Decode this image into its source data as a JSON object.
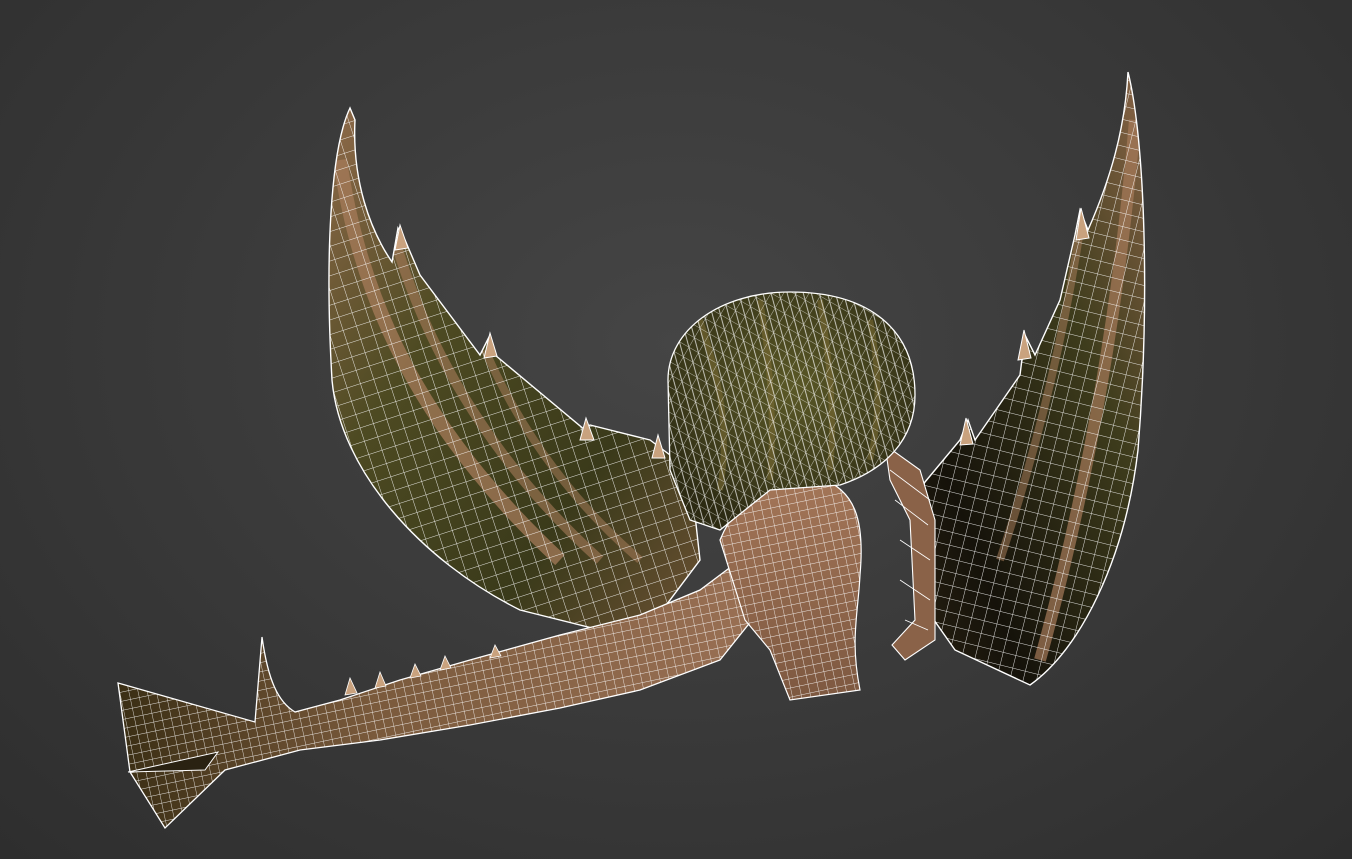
{
  "viewport": {
    "background_color": "#3a3a3a",
    "display_mode": "textured-wireframe"
  },
  "model": {
    "subject": "dragon",
    "wireframe_color": "#ffffff",
    "wing_membrane_color": "#4a4a22",
    "wing_rib_color": "#a37a5c",
    "body_color": "#9a6e52",
    "dark_membrane_color": "#141008"
  }
}
